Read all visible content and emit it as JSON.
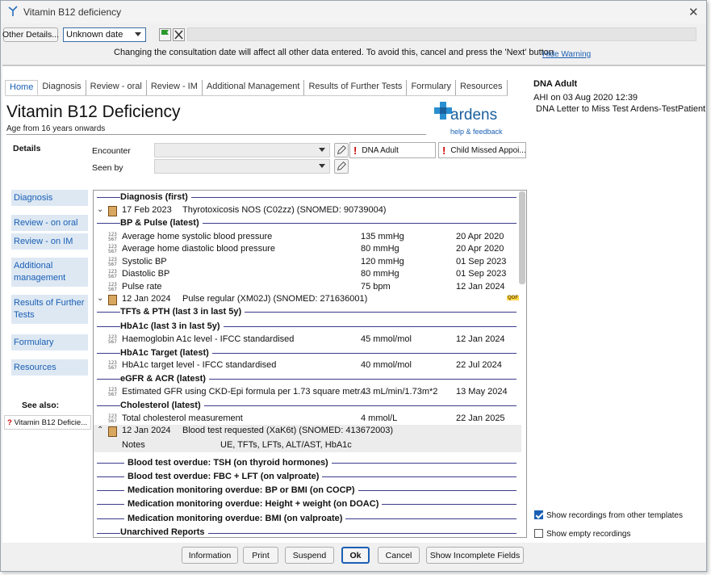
{
  "window": {
    "title": "Vitamin B12 deficiency"
  },
  "toolbar": {
    "other_details": "Other Details...",
    "date_value": "Unknown date"
  },
  "warning": {
    "text": "Changing the consultation date will affect all other data entered. To avoid this, cancel and press the 'Next' button",
    "hide": "Hide Warning"
  },
  "tabs": [
    "Home",
    "Diagnosis",
    "Review - oral",
    "Review - IM",
    "Additional Management",
    "Results of Further Tests",
    "Formulary",
    "Resources"
  ],
  "page": {
    "title": "Vitamin B12 Deficiency",
    "subtitle": "Age from 16 years onwards"
  },
  "logo": {
    "name": "ardens",
    "tagline": "help & feedback"
  },
  "details": {
    "label": "Details",
    "encounter_label": "Encounter",
    "seen_by_label": "Seen by",
    "flag1": "DNA Adult",
    "flag2": "Child Missed Appoi..."
  },
  "sidebar": [
    "Diagnosis",
    "Review - on oral",
    "Review - on IM",
    "Additional management",
    "Results of Further Tests",
    "Formulary",
    "Resources"
  ],
  "see_also": {
    "label": "See also:",
    "item": "Vitamin B12 Deficie..."
  },
  "list": {
    "h_diag": "Diagnosis (first)",
    "diag": {
      "date": "17 Feb 2023",
      "text": "Thyrotoxicosis NOS (C02zz) (SNOMED: 90739004)"
    },
    "h_bp": "BP & Pulse (latest)",
    "bp": [
      {
        "name": "Average home systolic blood pressure",
        "value": "135 mmHg",
        "date": "20 Apr 2020"
      },
      {
        "name": "Average home diastolic blood pressure",
        "value": "80 mmHg",
        "date": "20 Apr 2020"
      },
      {
        "name": "Systolic BP",
        "value": "120 mmHg",
        "date": "01 Sep 2023"
      },
      {
        "name": "Diastolic BP",
        "value": "80 mmHg",
        "date": "01 Sep 2023"
      },
      {
        "name": "Pulse rate",
        "value": "75 bpm",
        "date": "12 Jan 2024"
      }
    ],
    "pulse": {
      "date": "12 Jan 2024",
      "text": "Pulse regular (XM02J) (SNOMED: 271636001)",
      "badge": "QOF"
    },
    "h_tfts": "TFTs & PTH (last 3 in last 5y)",
    "h_hba1c": "HbA1c (last 3 in last 5y)",
    "hba1c": {
      "name": "Haemoglobin A1c level - IFCC standardised",
      "value": "45 mmol/mol",
      "date": "12 Jan 2024"
    },
    "h_target": "HbA1c Target (latest)",
    "target": {
      "name": "HbA1c target level - IFCC standardised",
      "value": "40 mmol/mol",
      "date": "22 Jul 2024"
    },
    "h_egfr": "eGFR & ACR (latest)",
    "egfr": {
      "name": "Estimated GFR using CKD-Epi formula per 1.73 square metr...",
      "value": "43 mL/min/1.73m*2",
      "date": "13 May 2024"
    },
    "h_chol": "Cholesterol (latest)",
    "chol": {
      "name": "Total cholesterol measurement",
      "value": "4 mmol/L",
      "date": "22 Jan 2025"
    },
    "blood": {
      "date": "12 Jan 2024",
      "text": "Blood test requested (XaK6t) (SNOMED: 413672003)",
      "notes_label": "Notes",
      "notes": "UE, TFTs, LFTs, ALT/AST, HbA1c"
    },
    "overdue": [
      "Blood test overdue: TSH (on thyroid hormones)",
      "Blood test overdue: FBC + LFT (on valproate)",
      "Medication monitoring overdue: BP or BMI (on COCP)",
      "Medication monitoring overdue: Height + weight (on DOAC)",
      "Medication monitoring overdue: BMI (on valproate)"
    ],
    "h_unarch": "Unarchived Reports"
  },
  "right": {
    "title": "DNA Adult",
    "line1": "AHI on 03 Aug 2020 12:39",
    "line2": "DNA Letter to Miss Test Ardens-TestPatient",
    "chk1": "Show recordings from other templates",
    "chk2": "Show empty recordings"
  },
  "buttons": {
    "information": "Information",
    "print": "Print",
    "suspend": "Suspend",
    "ok": "Ok",
    "cancel": "Cancel",
    "incomplete": "Show Incomplete Fields"
  }
}
